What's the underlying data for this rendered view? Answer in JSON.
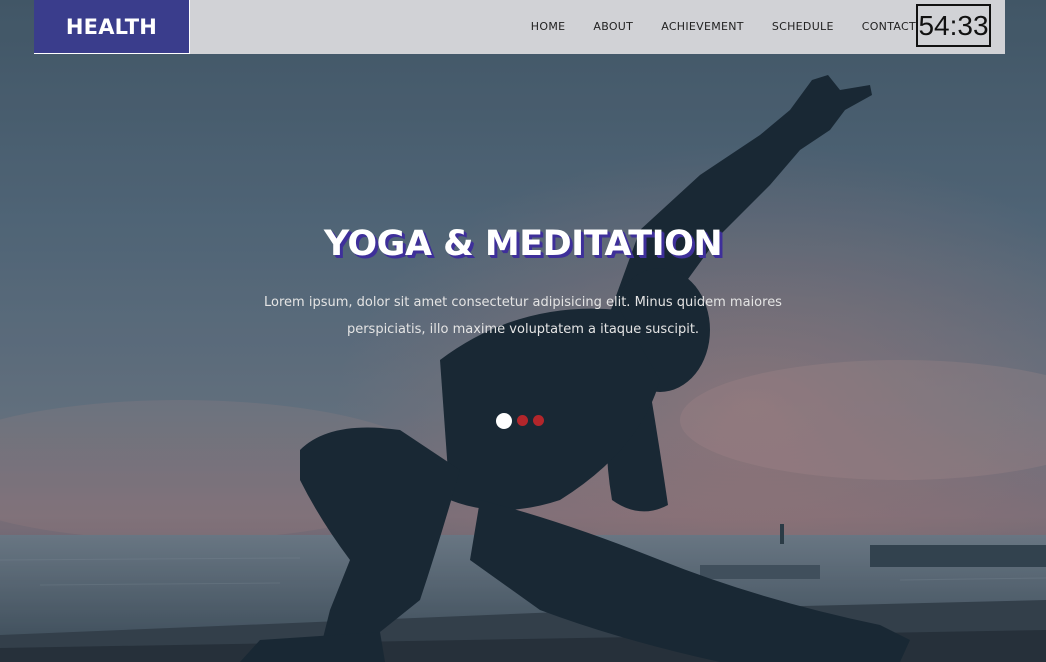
{
  "brand": {
    "name": "HEALTH"
  },
  "nav": {
    "items": [
      {
        "label": "HOME"
      },
      {
        "label": "ABOUT"
      },
      {
        "label": "ACHIEVEMENT"
      },
      {
        "label": "SCHEDULE"
      },
      {
        "label": "CONTACT"
      }
    ]
  },
  "clock": {
    "time": "54:33"
  },
  "hero": {
    "title": "YOGA & MEDITATION",
    "line1": "Lorem ipsum, dolor sit amet consectetur adipisicing elit. Minus quidem maiores",
    "line2": "perspiciatis, illo maxime voluptatem a itaque suscipit."
  },
  "slider": {
    "total": 3,
    "active_index": 0
  },
  "colors": {
    "brand_bg": "#3a3d8c",
    "nav_bg": "#d1d2d6",
    "title_shadow": "#3e2f9a",
    "dot_active": "#ffffff",
    "dot_idle": "#b3262b"
  }
}
